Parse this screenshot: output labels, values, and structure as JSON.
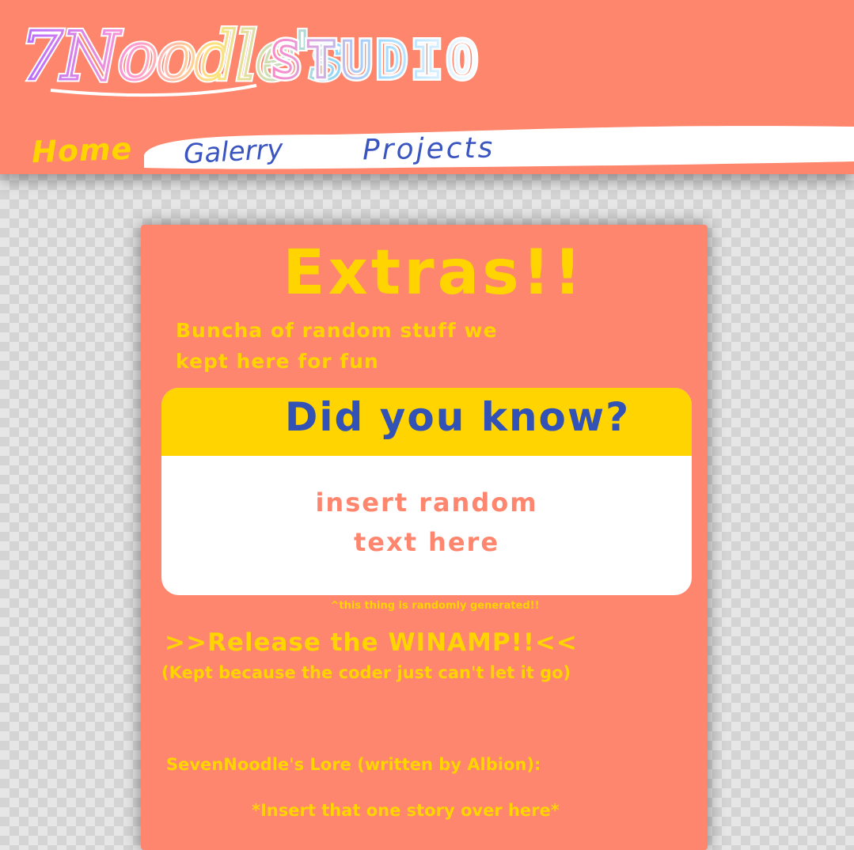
{
  "header": {
    "logo_text": "7Noodle's STUDIO",
    "nav": {
      "home": "Home",
      "gallery": "Galerry",
      "projects": "Projects"
    }
  },
  "main": {
    "title": "Extras!!",
    "subtitle_line1": "Buncha of random stuff we",
    "subtitle_line2": "kept here for fun",
    "card": {
      "title": "Did you know?",
      "body_line1": "insert random",
      "body_line2": "text here"
    },
    "card_note": "^this thing is randomly generated!!",
    "winamp_link": ">>Release the WINAMP!!<<",
    "winamp_note": "(Kept because the coder just can't let it go)",
    "lore_heading": "SevenNoodle's Lore (written by Albion):",
    "lore_text": "*Insert that one story over here*"
  },
  "colors": {
    "header_bg": "#fe866d",
    "panel_bg": "#ff866e",
    "yellow": "#ffd400",
    "blue": "#3352b6"
  }
}
